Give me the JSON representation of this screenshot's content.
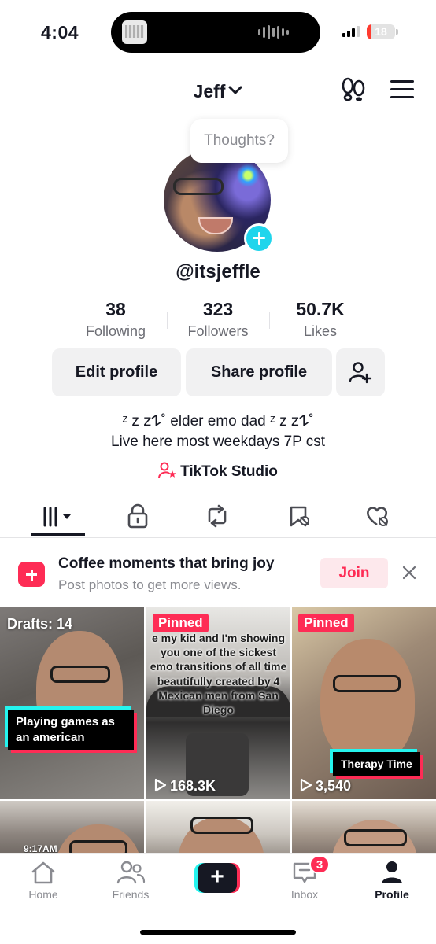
{
  "status_bar": {
    "time": "4:04",
    "battery": "18",
    "battery_level": 0.18,
    "signal_bars": 3
  },
  "header": {
    "title": "Jeff",
    "icons": [
      "chevron-down-icon",
      "footprints-icon",
      "hamburger-menu-icon"
    ]
  },
  "profile": {
    "thoughts_bubble": "Thoughts?",
    "handle": "@itsjeffle",
    "stats": [
      {
        "value": "38",
        "label": "Following"
      },
      {
        "value": "323",
        "label": "Followers"
      },
      {
        "value": "50.7K",
        "label": "Likes"
      }
    ],
    "buttons": {
      "edit": "Edit profile",
      "share": "Share profile"
    },
    "bio_line1": "ᶻ z 𝗓𐰁˚ elder emo dad ᶻ z 𝗓𐰁˚",
    "bio_line2": "Live here most weekdays 7P cst",
    "studio_link": "TikTok Studio"
  },
  "tabs": [
    "videos-grid-icon",
    "lock-icon",
    "repost-icon",
    "saved-icon",
    "liked-icon"
  ],
  "promo": {
    "title": "Coffee moments that bring joy",
    "subtitle": "Post photos to get more views.",
    "join_label": "Join"
  },
  "videos": [
    {
      "badge": "Drafts: 14",
      "caption": "Playing games as an american"
    },
    {
      "badge": "Pinned",
      "overlay": "e my kid and I'm showing you one of the sickest emo transitions of all time beautifully created by 4 Mexican men from San Diego",
      "views": "168.3K"
    },
    {
      "badge": "Pinned",
      "caption": "Therapy Time",
      "views": "3,540"
    },
    {
      "timestamp": "9:17AM"
    },
    {},
    {}
  ],
  "nav": {
    "items": [
      {
        "label": "Home"
      },
      {
        "label": "Friends"
      },
      {
        "label": "Inbox",
        "badge": "3"
      },
      {
        "label": "Profile"
      }
    ]
  },
  "colors": {
    "accent_red": "#fe2c55",
    "accent_cyan": "#25f4ee",
    "text": "#161823",
    "secondary_text": "#8a8b91"
  }
}
